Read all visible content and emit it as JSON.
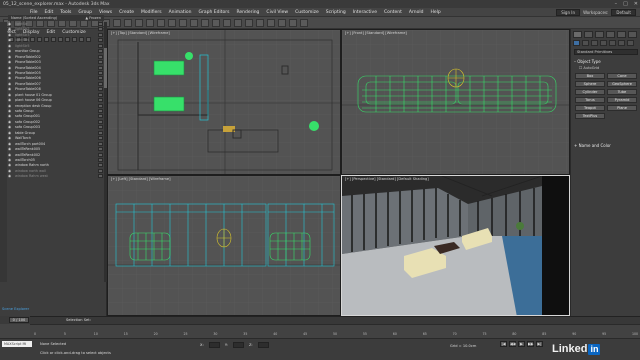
{
  "window": {
    "title": "05_12_scene_explorer.max - Autodesk 3ds Max",
    "controls": [
      "–",
      "□",
      "✕"
    ]
  },
  "menubar": {
    "items": [
      "File",
      "Edit",
      "Tools",
      "Group",
      "Views",
      "Create",
      "Modifiers",
      "Animation",
      "Graph Editors",
      "Rendering",
      "Civil View",
      "Customize",
      "Scripting",
      "Interactive",
      "Content",
      "Arnold",
      "Help"
    ],
    "sign_in": "Sign In",
    "workspaces_label": "Workspaces:",
    "workspaces_value": "Default"
  },
  "toolbar": {
    "buttons": [
      "undo-icon",
      "redo-icon",
      "link-icon",
      "unlink-icon",
      "bind-icon",
      "filter-icon",
      "select-icon",
      "select-name-icon",
      "region-icon",
      "window-icon",
      "move-icon",
      "rotate-icon",
      "scale-icon",
      "pivot-icon",
      "snap-icon",
      "angle-snap-icon",
      "percent-snap-icon",
      "spinner-snap-icon",
      "named-sel-icon",
      "mirror-icon",
      "align-icon",
      "layer-icon",
      "curve-icon",
      "schematic-icon",
      "material-icon",
      "render-setup-icon",
      "render-frame-icon",
      "render-icon"
    ]
  },
  "explorer": {
    "tabs": [
      "Select",
      "Display",
      "Edit",
      "Customize"
    ],
    "header_name": "Name (Sorted Ascending)",
    "header_right": "▲ Frozen",
    "items": [
      {
        "name": "lightStr",
        "dim": true
      },
      {
        "name": "lightStr2",
        "dim": true
      },
      {
        "name": "lightStr3",
        "dim": true
      },
      {
        "name": "lightStr4",
        "dim": true
      },
      {
        "name": "lightStr5",
        "dim": true
      },
      {
        "name": "monitor Group",
        "dim": false
      },
      {
        "name": "PhoneTable002",
        "dim": false
      },
      {
        "name": "PhoneTable003",
        "dim": false
      },
      {
        "name": "PhoneTable004",
        "dim": false
      },
      {
        "name": "PhoneTable005",
        "dim": false
      },
      {
        "name": "PhoneTable006",
        "dim": false
      },
      {
        "name": "PhoneTable007",
        "dim": false
      },
      {
        "name": "PhoneTable008",
        "dim": false
      },
      {
        "name": "plant house 01 Group",
        "dim": false
      },
      {
        "name": "plant house 06 Group",
        "dim": false
      },
      {
        "name": "reception desk Group",
        "dim": false
      },
      {
        "name": "sofa Group",
        "dim": false
      },
      {
        "name": "sofa Group001",
        "dim": false
      },
      {
        "name": "sofa Group002",
        "dim": false
      },
      {
        "name": "sofa Group003",
        "dim": false
      },
      {
        "name": "table Group",
        "dim": false
      },
      {
        "name": "WallTorch",
        "dim": false
      },
      {
        "name": "wallTorch part004",
        "dim": false
      },
      {
        "name": "wallTeRenk005",
        "dim": false
      },
      {
        "name": "wallTeRenk002",
        "dim": false
      },
      {
        "name": "wallTorch05",
        "dim": false
      },
      {
        "name": "window Rahm north",
        "dim": false
      },
      {
        "name": "window north wall",
        "dim": true
      },
      {
        "name": "window Rahm west",
        "dim": true
      }
    ],
    "layer_label": "Scene Explorer",
    "selection_set": "Selection Set:"
  },
  "viewports": {
    "top": "[+] [Top] [Standard] [Wireframe]",
    "front": "[+] [Front] [Standard] [Wireframe]",
    "left": "[+] [Left] [Standard] [Wireframe]",
    "perspective": "[+] [Perspective] [Standard] [Default Shading]"
  },
  "command_panel": {
    "dropdown": "Standard Primitives",
    "object_type_title": "Object Type",
    "autogrid": "AutoGrid",
    "primitives": [
      "Box",
      "Cone",
      "Sphere",
      "GeoSphere",
      "Cylinder",
      "Tube",
      "Torus",
      "Pyramid",
      "Teapot",
      "Plane",
      "TextPlus"
    ],
    "name_color_title": "Name and Color"
  },
  "timeline": {
    "knob": "0 / 100",
    "ticks": [
      "0",
      "5",
      "10",
      "15",
      "20",
      "25",
      "30",
      "35",
      "40",
      "45",
      "50",
      "55",
      "60",
      "65",
      "70",
      "75",
      "80",
      "85",
      "90",
      "95",
      "100"
    ]
  },
  "status": {
    "maxscript": "MAXScript Mi",
    "line1": "None Selected",
    "line2": "Click or click-and-drag to select objects",
    "x_label": "X:",
    "y_label": "Y:",
    "z_label": "Z:",
    "grid": "Grid = 10.0cm",
    "playback": [
      "|◀",
      "◀◀",
      "▶",
      "▶▶",
      "▶|"
    ]
  },
  "brand": {
    "text": "Linked",
    "box": "in"
  },
  "colors": {
    "wire_green": "#37e06a",
    "wire_cyan": "#23c7d8",
    "wire_yellow": "#d8c52a",
    "accent_blue": "#3e6fa3"
  }
}
